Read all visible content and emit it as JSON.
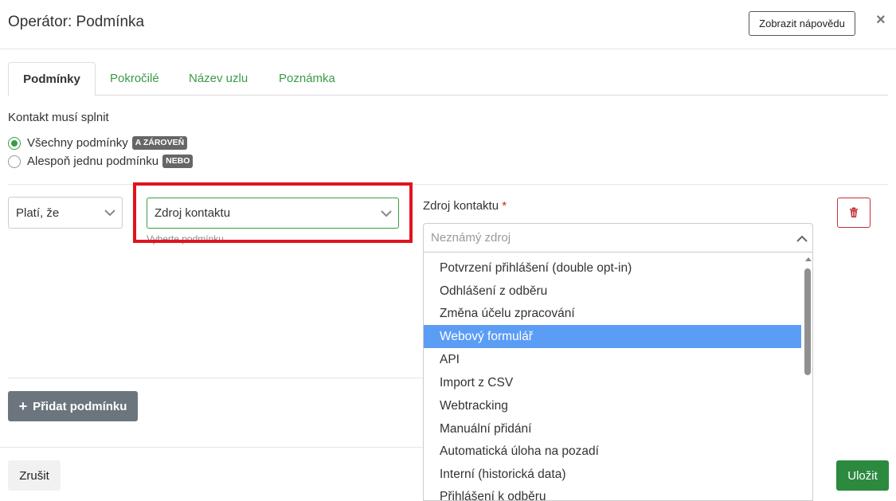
{
  "modal": {
    "title": "Operátor: Podmínka",
    "help_label": "Zobrazit nápovědu",
    "close_symbol": "×"
  },
  "tabs": [
    {
      "label": "Podmínky",
      "active": true
    },
    {
      "label": "Pokročilé",
      "active": false
    },
    {
      "label": "Název uzlu",
      "active": false
    },
    {
      "label": "Poznámka",
      "active": false
    }
  ],
  "conditions": {
    "label": "Kontakt musí splnit",
    "options": [
      {
        "label": "Všechny podmínky",
        "badge": "A ZÁROVEŇ",
        "checked": true
      },
      {
        "label": "Alespoň jednu podmínku",
        "badge": "NEBO",
        "checked": false
      }
    ]
  },
  "rule": {
    "operator_value": "Platí, že",
    "field_value": "Zdroj kontaktu",
    "field_helper": "Vyberte podmínku"
  },
  "source_field": {
    "label": "Zdroj kontaktu",
    "required_mark": "*",
    "placeholder": "Neznámý zdroj",
    "options": [
      "Potvrzení přihlášení (double opt-in)",
      "Odhlášení z odběru",
      "Změna účelu zpracování",
      "Webový formulář",
      "API",
      "Import z CSV",
      "Webtracking",
      "Manuální přidání",
      "Automatická úloha na pozadí",
      "Interní (historická data)",
      "Přihlášení k odběru"
    ],
    "highlighted": "Webový formulář"
  },
  "actions": {
    "add_condition": "Přidat podmínku",
    "add_icon": "plus-icon",
    "cancel": "Zrušit",
    "save": "Uložit"
  },
  "colors": {
    "accent_green": "#3a9b47",
    "save_green": "#2c8a3f",
    "highlight_blue": "#5b9cf5",
    "annotation_red": "#e0141e",
    "delete_red": "#c5323a"
  }
}
